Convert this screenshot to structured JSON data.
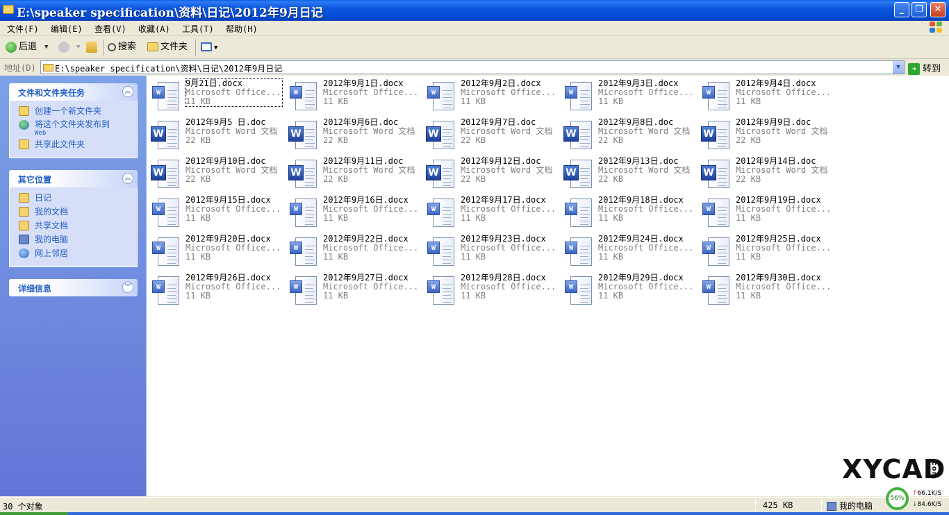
{
  "window": {
    "title": "E:\\speaker specification\\资料\\日记\\2012年9月日记",
    "minimize": "_",
    "maximize": "❐",
    "close": "✕"
  },
  "menu": [
    "文件(F)",
    "编辑(E)",
    "查看(V)",
    "收藏(A)",
    "工具(T)",
    "帮助(H)"
  ],
  "toolbar": {
    "back": "后退",
    "search": "搜索",
    "folders": "文件夹"
  },
  "address": {
    "label": "地址(D)",
    "path": "E:\\speaker specification\\资料\\日记\\2012年9月日记",
    "go": "转到"
  },
  "sidebar": {
    "tasks": {
      "title": "文件和文件夹任务",
      "items": [
        "创建一个新文件夹",
        "将这个文件夹发布到",
        "共享此文件夹"
      ],
      "publish_sub": "Web"
    },
    "places": {
      "title": "其它位置",
      "items": [
        "日记",
        "我的文档",
        "共享文档",
        "我的电脑",
        "网上邻居"
      ]
    },
    "details": {
      "title": "详细信息"
    }
  },
  "files": [
    {
      "name": "9月21日.docx",
      "type": "Microsoft Office...",
      "size": "11 KB",
      "icon": "docx-icon"
    },
    {
      "name": "2012年9月1日.docx",
      "type": "Microsoft Office...",
      "size": "11 KB",
      "icon": "docx-icon"
    },
    {
      "name": "2012年9月2日.docx",
      "type": "Microsoft Office...",
      "size": "11 KB",
      "icon": "docx-icon"
    },
    {
      "name": "2012年9月3日.docx",
      "type": "Microsoft Office...",
      "size": "11 KB",
      "icon": "docx-icon"
    },
    {
      "name": "2012年9月4日.docx",
      "type": "Microsoft Office...",
      "size": "11 KB",
      "icon": "docx-icon"
    },
    {
      "name": "2012年9月5 日.doc",
      "type": "Microsoft Word 文档",
      "size": "22 KB",
      "icon": "doc-icon"
    },
    {
      "name": "2012年9月6日.doc",
      "type": "Microsoft Word 文档",
      "size": "22 KB",
      "icon": "doc-icon"
    },
    {
      "name": "2012年9月7日.doc",
      "type": "Microsoft Word 文档",
      "size": "22 KB",
      "icon": "doc-icon"
    },
    {
      "name": "2012年9月8日.doc",
      "type": "Microsoft Word 文档",
      "size": "22 KB",
      "icon": "doc-icon"
    },
    {
      "name": "2012年9月9日.doc",
      "type": "Microsoft Word 文档",
      "size": "22 KB",
      "icon": "doc-icon"
    },
    {
      "name": "2012年9月10日.doc",
      "type": "Microsoft Word 文档",
      "size": "22 KB",
      "icon": "doc-icon"
    },
    {
      "name": "2012年9月11日.doc",
      "type": "Microsoft Word 文档",
      "size": "22 KB",
      "icon": "doc-icon"
    },
    {
      "name": "2012年9月12日.doc",
      "type": "Microsoft Word 文档",
      "size": "22 KB",
      "icon": "doc-icon"
    },
    {
      "name": "2012年9月13日.doc",
      "type": "Microsoft Word 文档",
      "size": "22 KB",
      "icon": "doc-icon"
    },
    {
      "name": "2012年9月14日.doc",
      "type": "Microsoft Word 文档",
      "size": "22 KB",
      "icon": "doc-icon"
    },
    {
      "name": "2012年9月15日.docx",
      "type": "Microsoft Office...",
      "size": "11 KB",
      "icon": "docx-icon"
    },
    {
      "name": "2012年9月16日.docx",
      "type": "Microsoft Office...",
      "size": "11 KB",
      "icon": "docx-icon"
    },
    {
      "name": "2012年9月17日.docx",
      "type": "Microsoft Office...",
      "size": "11 KB",
      "icon": "docx-icon"
    },
    {
      "name": "2012年9月18日.docx",
      "type": "Microsoft Office...",
      "size": "11 KB",
      "icon": "docx-icon"
    },
    {
      "name": "2012年9月19日.docx",
      "type": "Microsoft Office...",
      "size": "11 KB",
      "icon": "docx-icon"
    },
    {
      "name": "2012年9月20日.docx",
      "type": "Microsoft Office...",
      "size": "11 KB",
      "icon": "docx-icon"
    },
    {
      "name": "2012年9月22日.docx",
      "type": "Microsoft Office...",
      "size": "11 KB",
      "icon": "docx-icon"
    },
    {
      "name": "2012年9月23日.docx",
      "type": "Microsoft Office...",
      "size": "11 KB",
      "icon": "docx-icon"
    },
    {
      "name": "2012年9月24日.docx",
      "type": "Microsoft Office...",
      "size": "11 KB",
      "icon": "docx-icon"
    },
    {
      "name": "2012年9月25日.docx",
      "type": "Microsoft Office...",
      "size": "11 KB",
      "icon": "docx-icon"
    },
    {
      "name": "2012年9月26日.docx",
      "type": "Microsoft Office...",
      "size": "11 KB",
      "icon": "docx-icon"
    },
    {
      "name": "2012年9月27日.docx",
      "type": "Microsoft Office...",
      "size": "11 KB",
      "icon": "docx-icon"
    },
    {
      "name": "2012年9月28日.docx",
      "type": "Microsoft Office...",
      "size": "11 KB",
      "icon": "docx-icon"
    },
    {
      "name": "2012年9月29日.docx",
      "type": "Microsoft Office...",
      "size": "11 KB",
      "icon": "docx-icon"
    },
    {
      "name": "2012年9月30日.docx",
      "type": "Microsoft Office...",
      "size": "11 KB",
      "icon": "docx-icon"
    }
  ],
  "status": {
    "count": "30 个对象",
    "total_size": "425 KB",
    "location": "我的电脑"
  },
  "watermark": {
    "text": "XYCAD",
    "suffix": ".com"
  },
  "network": {
    "percent": "56%",
    "up": "66.1K/S",
    "down": "84.6K/S"
  },
  "colors": {
    "title_bar": "#0A5FE8",
    "sidebar_link": "#215DC6",
    "word_icon": "#1E3F9A"
  }
}
